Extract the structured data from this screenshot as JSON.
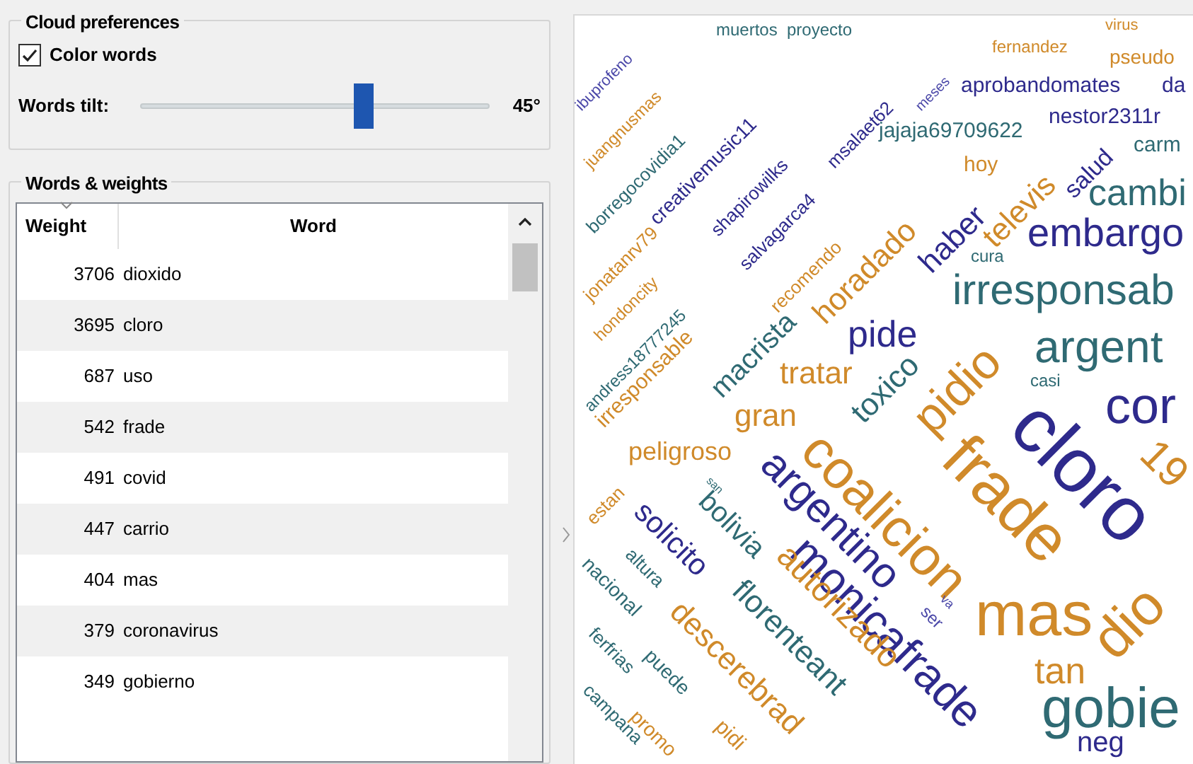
{
  "cloud_preferences": {
    "title": "Cloud preferences",
    "color_words": {
      "label": "Color words",
      "checked": true
    },
    "words_tilt": {
      "label": "Words tilt:",
      "level": 0.64,
      "reading": "45°"
    }
  },
  "words_weights": {
    "title": "Words & weights",
    "columns": [
      "Weight",
      "Word"
    ],
    "rows": [
      {
        "weight": "3706",
        "word": "dioxido"
      },
      {
        "weight": "3695",
        "word": "cloro"
      },
      {
        "weight": "687",
        "word": "uso"
      },
      {
        "weight": "542",
        "word": "frade"
      },
      {
        "weight": "491",
        "word": "covid"
      },
      {
        "weight": "447",
        "word": "carrio"
      },
      {
        "weight": "404",
        "word": "mas"
      },
      {
        "weight": "379",
        "word": "coronavirus"
      },
      {
        "weight": "349",
        "word": "gobierno"
      }
    ]
  },
  "cloud": {
    "words": [
      {
        "text": "ibuprofeno",
        "kind": "rising",
        "color": "#4a47a8"
      },
      {
        "text": "juangnusmas",
        "kind": "rising",
        "color": "#d08a2a"
      },
      {
        "text": "borregocovidia1",
        "kind": "rising",
        "color": "#2f6a73"
      },
      {
        "text": "jonatanrv79",
        "kind": "rising",
        "color": "#d08a2a"
      },
      {
        "text": "creativemusic11",
        "kind": "rising",
        "color": "#2e2a8c"
      },
      {
        "text": "shapirowilks",
        "kind": "rising",
        "color": "#2e2a8c"
      },
      {
        "text": "msalaet62",
        "kind": "rising",
        "color": "#2e2a8c"
      },
      {
        "text": "meses",
        "kind": "rising",
        "color": "#4a47a8"
      },
      {
        "text": "hondoncity",
        "kind": "rising",
        "color": "#d08a2a"
      },
      {
        "text": "salvagarca4",
        "kind": "rising",
        "color": "#2e2a8c"
      },
      {
        "text": "andress18777245",
        "kind": "rising",
        "color": "#2f6a73"
      },
      {
        "text": "recomendo",
        "kind": "rising",
        "color": "#d08a2a"
      },
      {
        "text": "irresponsable",
        "kind": "rising",
        "color": "#d08a2a"
      },
      {
        "text": "macrista",
        "kind": "rising",
        "color": "#2f6a73"
      },
      {
        "text": "horadado",
        "kind": "rising",
        "color": "#d08a2a"
      },
      {
        "text": "haber",
        "kind": "rising",
        "color": "#2e2a8c"
      },
      {
        "text": "televis",
        "kind": "rising",
        "color": "#d08a2a"
      },
      {
        "text": "salud",
        "kind": "rising",
        "color": "#2e2a8c"
      },
      {
        "text": "toxico",
        "kind": "rising",
        "color": "#2f6a73"
      },
      {
        "text": "pidio",
        "kind": "rising",
        "color": "#d08a2a"
      },
      {
        "text": "estan",
        "kind": "rising",
        "color": "#d08a2a"
      },
      {
        "text": "dio",
        "kind": "rising",
        "color": "#d08a2a"
      },
      {
        "text": "coalicion",
        "kind": "falling",
        "color": "#d08a2a"
      },
      {
        "text": "frade",
        "kind": "falling",
        "color": "#d08a2a"
      },
      {
        "text": "cloro",
        "kind": "falling",
        "color": "#2e2a8c"
      },
      {
        "text": "argentino",
        "kind": "falling",
        "color": "#2e2a8c"
      },
      {
        "text": "monicafrade",
        "kind": "falling",
        "color": "#2e2a8c"
      },
      {
        "text": "bolivia",
        "kind": "falling",
        "color": "#2f6a73"
      },
      {
        "text": "solicito",
        "kind": "falling",
        "color": "#2e2a8c"
      },
      {
        "text": "altura",
        "kind": "falling",
        "color": "#2f6a73"
      },
      {
        "text": "nacional",
        "kind": "falling",
        "color": "#2f6a73"
      },
      {
        "text": "ferfrias",
        "kind": "falling",
        "color": "#2f6a73"
      },
      {
        "text": "puede",
        "kind": "falling",
        "color": "#2f6a73"
      },
      {
        "text": "descerebrad",
        "kind": "falling",
        "color": "#d08a2a"
      },
      {
        "text": "florenteant",
        "kind": "falling",
        "color": "#2f6a73"
      },
      {
        "text": "autorizado",
        "kind": "falling",
        "color": "#d08a2a"
      },
      {
        "text": "campana",
        "kind": "falling",
        "color": "#2f6a73"
      },
      {
        "text": "promo",
        "kind": "falling",
        "color": "#d08a2a"
      },
      {
        "text": "pidi",
        "kind": "falling",
        "color": "#d08a2a"
      },
      {
        "text": "san",
        "kind": "falling",
        "color": "#2f6a73"
      },
      {
        "text": "va",
        "kind": "falling",
        "color": "#4a47a8"
      },
      {
        "text": "ser",
        "kind": "falling",
        "color": "#4a47a8"
      },
      {
        "text": "19",
        "kind": "falling",
        "color": "#d08a2a"
      },
      {
        "text": "muertos",
        "kind": "horizontal",
        "color": "#2f6a73"
      },
      {
        "text": "proyecto",
        "kind": "horizontal",
        "color": "#2f6a73"
      },
      {
        "text": "fernandez",
        "kind": "horizontal",
        "color": "#d08a2a"
      },
      {
        "text": "virus",
        "kind": "horizontal",
        "color": "#d08a2a"
      },
      {
        "text": "pseudo",
        "kind": "horizontal",
        "color": "#d08a2a"
      },
      {
        "text": "aprobandomates",
        "kind": "horizontal",
        "color": "#2e2a8c"
      },
      {
        "text": "da",
        "kind": "horizontal",
        "color": "#2e2a8c"
      },
      {
        "text": "jajaja69709622",
        "kind": "horizontal",
        "color": "#2f6a73"
      },
      {
        "text": "nestor2311r",
        "kind": "horizontal",
        "color": "#2e2a8c"
      },
      {
        "text": "carm",
        "kind": "horizontal",
        "color": "#2f6a73"
      },
      {
        "text": "hoy",
        "kind": "horizontal",
        "color": "#d08a2a"
      },
      {
        "text": "cambi",
        "kind": "horizontal",
        "color": "#2f6a73"
      },
      {
        "text": "embargo",
        "kind": "horizontal",
        "color": "#2e2a8c"
      },
      {
        "text": "cura",
        "kind": "horizontal",
        "color": "#2f6a73"
      },
      {
        "text": "irresponsab",
        "kind": "horizontal",
        "color": "#2f6a73"
      },
      {
        "text": "pide",
        "kind": "horizontal",
        "color": "#2e2a8c"
      },
      {
        "text": "argent",
        "kind": "horizontal",
        "color": "#2f6a73"
      },
      {
        "text": "tratar",
        "kind": "horizontal",
        "color": "#d08a2a"
      },
      {
        "text": "casi",
        "kind": "horizontal",
        "color": "#2f6a73"
      },
      {
        "text": "gran",
        "kind": "horizontal",
        "color": "#d08a2a"
      },
      {
        "text": "cor",
        "kind": "horizontal",
        "color": "#2e2a8c"
      },
      {
        "text": "peligroso",
        "kind": "horizontal",
        "color": "#d08a2a"
      },
      {
        "text": "mas",
        "kind": "horizontal",
        "color": "#d08a2a"
      },
      {
        "text": "tan",
        "kind": "horizontal",
        "color": "#d08a2a"
      },
      {
        "text": "gobie",
        "kind": "horizontal",
        "color": "#2f6a73"
      },
      {
        "text": "neg",
        "kind": "horizontal",
        "color": "#2e2a8c"
      }
    ]
  }
}
